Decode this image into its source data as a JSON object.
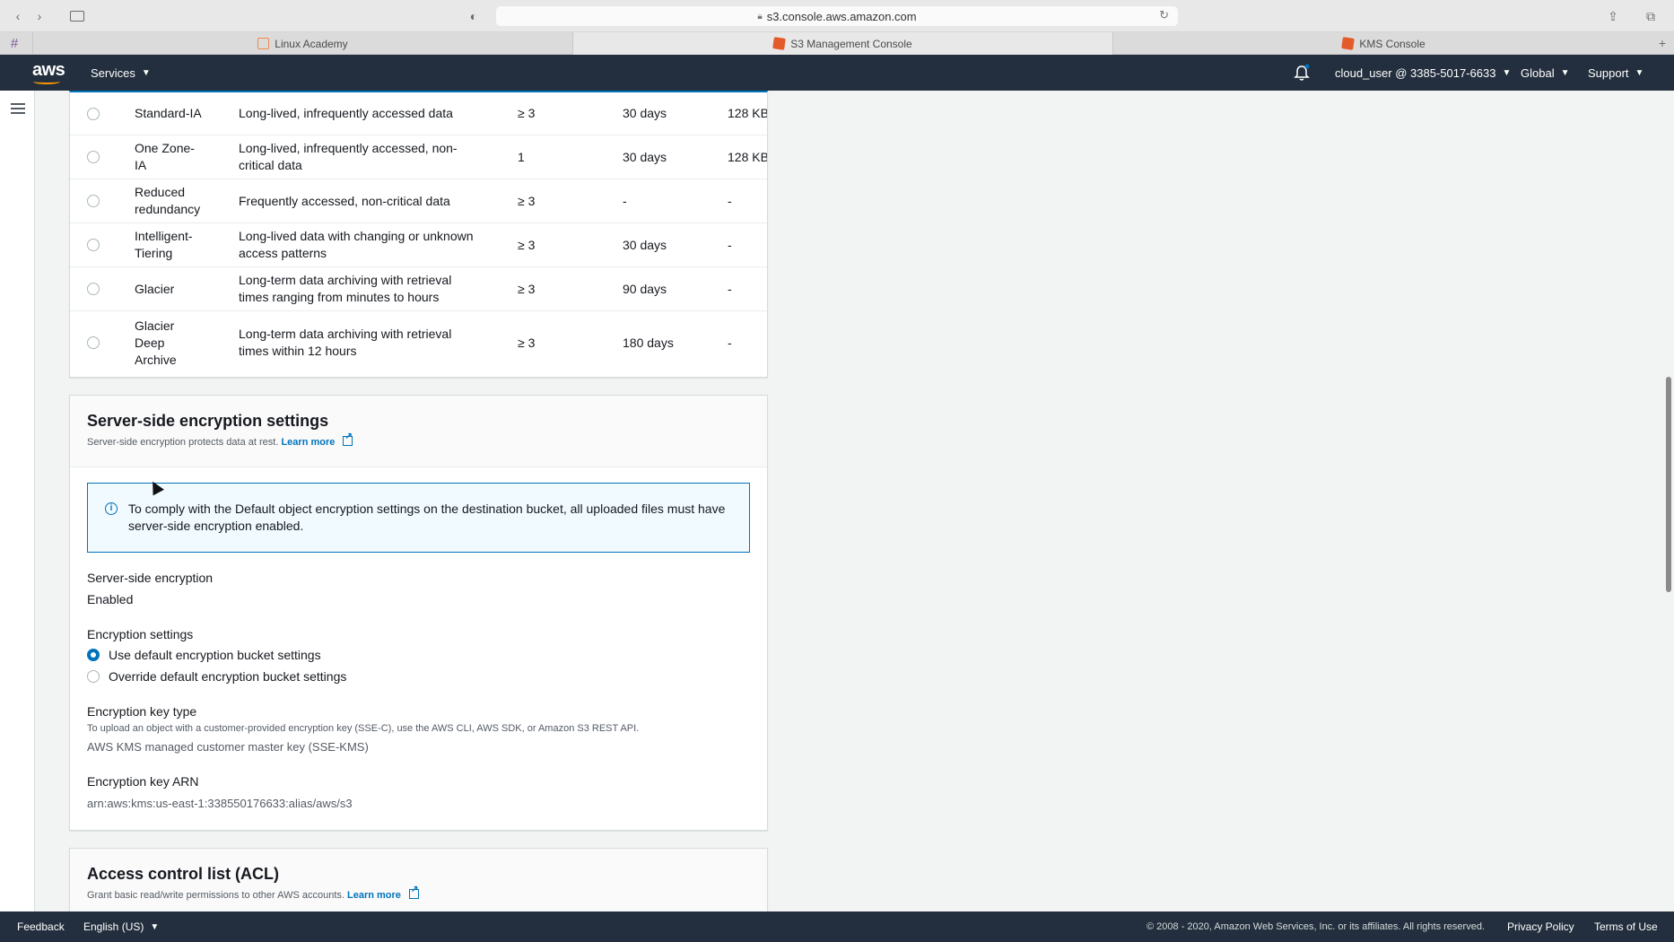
{
  "browser": {
    "url": "s3.console.aws.amazon.com",
    "tabs": [
      {
        "label": "Linux Academy"
      },
      {
        "label": "S3 Management Console"
      },
      {
        "label": "KMS Console"
      }
    ]
  },
  "header": {
    "logo": "aws",
    "services": "Services",
    "account": "cloud_user @ 3385-5017-6633",
    "region": "Global",
    "support": "Support"
  },
  "storage_classes": [
    {
      "name": "Standard-IA",
      "use": "Long-lived, infrequently accessed data",
      "az": "≥ 3",
      "min_duration": "30 days",
      "min_size": "128 KB"
    },
    {
      "name": "One Zone-IA",
      "use": "Long-lived, infrequently accessed, non-critical data",
      "az": "1",
      "min_duration": "30 days",
      "min_size": "128 KB"
    },
    {
      "name": "Reduced redundancy",
      "use": "Frequently accessed, non-critical data",
      "az": "≥ 3",
      "min_duration": "-",
      "min_size": "-"
    },
    {
      "name": "Intelligent-Tiering",
      "use": "Long-lived data with changing or unknown access patterns",
      "az": "≥ 3",
      "min_duration": "30 days",
      "min_size": "-"
    },
    {
      "name": "Glacier",
      "use": "Long-term data archiving with retrieval times ranging from minutes to hours",
      "az": "≥ 3",
      "min_duration": "90 days",
      "min_size": "-"
    },
    {
      "name": "Glacier Deep Archive",
      "use": "Long-term data archiving with retrieval times within 12 hours",
      "az": "≥ 3",
      "min_duration": "180 days",
      "min_size": "-"
    }
  ],
  "encryption": {
    "title": "Server-side encryption settings",
    "desc": "Server-side encryption protects data at rest.",
    "learn_more": "Learn more",
    "info": "To comply with the Default object encryption settings on the destination bucket, all uploaded files must have server-side encryption enabled.",
    "sse_label": "Server-side encryption",
    "sse_value": "Enabled",
    "settings_label": "Encryption settings",
    "option_default": "Use default encryption bucket settings",
    "option_override": "Override default encryption bucket settings",
    "key_type_label": "Encryption key type",
    "key_type_help": "To upload an object with a customer-provided encryption key (SSE-C), use the AWS CLI, AWS SDK, or Amazon S3 REST API.",
    "key_type_value": "AWS KMS managed customer master key (SSE-KMS)",
    "key_arn_label": "Encryption key ARN",
    "key_arn_value": "arn:aws:kms:us-east-1:338550176633:alias/aws/s3"
  },
  "acl": {
    "title": "Access control list (ACL)",
    "desc": "Grant basic read/write permissions to other AWS accounts.",
    "learn_more": "Learn more"
  },
  "footer": {
    "feedback": "Feedback",
    "language": "English (US)",
    "copyright": "© 2008 - 2020, Amazon Web Services, Inc. or its affiliates. All rights reserved.",
    "privacy": "Privacy Policy",
    "terms": "Terms of Use"
  },
  "colors": {
    "header_bg": "#232f3e",
    "link": "#0073bb",
    "accent": "#ff9900"
  }
}
